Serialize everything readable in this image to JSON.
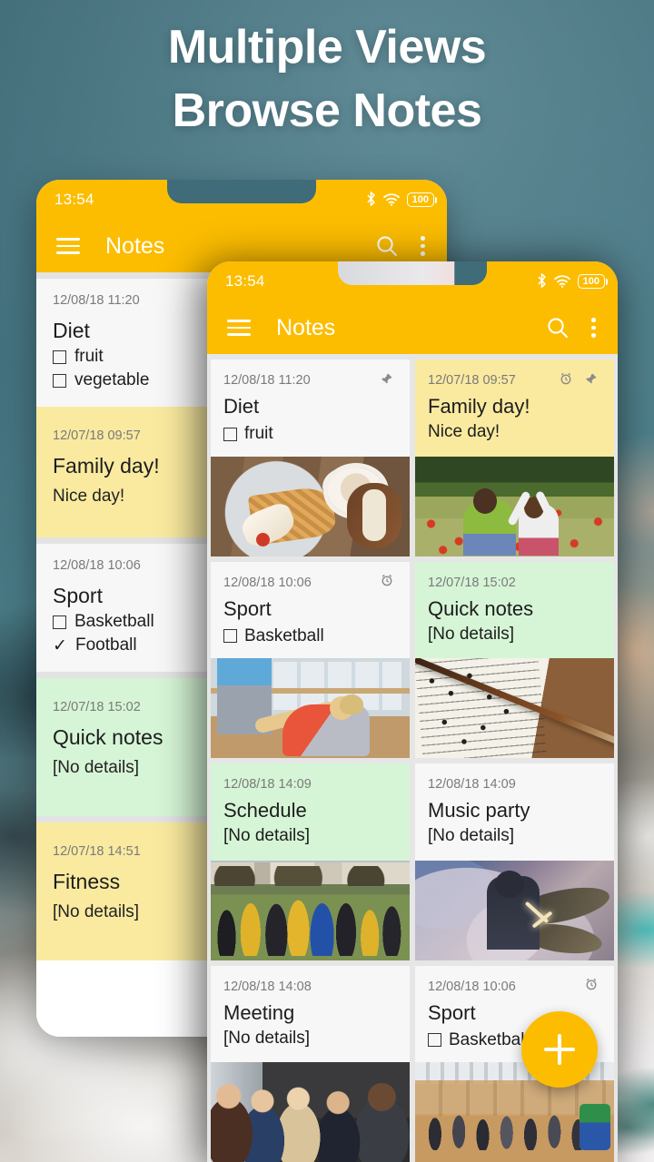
{
  "headline": {
    "line1": "Multiple Views",
    "line2": "Browse Notes"
  },
  "colors": {
    "toolbar": "#fcbd00",
    "accent_fab": "#fcbd00",
    "note_yellow": "#faeaa0",
    "note_green": "#d6f5d6",
    "note_white": "#f7f7f8",
    "background_teal": "#41707c"
  },
  "status_bar": {
    "time": "13:54",
    "bluetooth_icon": "bluetooth-icon",
    "wifi_icon": "wifi-icon",
    "battery_label": "100"
  },
  "toolbar": {
    "menu_icon": "hamburger-menu-icon",
    "title": "Notes",
    "search_icon": "search-icon",
    "overflow_icon": "overflow-menu-icon"
  },
  "fab": {
    "icon": "plus-icon",
    "label": "+"
  },
  "list_view": {
    "items": [
      {
        "date": "12/08/18 11:20",
        "title": "Diet",
        "color": "white",
        "pinned": true,
        "alarm": false,
        "checklist": [
          {
            "text": "fruit",
            "checked": false
          },
          {
            "text": "vegetable",
            "checked": false
          }
        ]
      },
      {
        "date": "12/07/18 09:57",
        "title": "Family day!",
        "subtitle": "Nice day!",
        "color": "yellow",
        "pinned": true,
        "alarm": true
      },
      {
        "date": "12/08/18 10:06",
        "title": "Sport",
        "color": "white",
        "pinned": false,
        "alarm": true,
        "checklist": [
          {
            "text": "Basketball",
            "checked": false
          },
          {
            "text": "Football",
            "checked": true
          }
        ]
      },
      {
        "date": "12/07/18 15:02",
        "title": "Quick notes",
        "subtitle": "[No details]",
        "color": "green",
        "pinned": false,
        "alarm": false
      },
      {
        "date": "12/07/18 14:51",
        "title": "Fitness",
        "subtitle": "[No details]",
        "color": "yellow",
        "pinned": false,
        "alarm": true
      }
    ]
  },
  "grid_view": {
    "cards": [
      {
        "date": "12/08/18 11:20",
        "title": "Diet",
        "color": "white",
        "pinned": true,
        "alarm": false,
        "checklist": [
          {
            "text": "fruit",
            "checked": false
          }
        ],
        "photo": "breakfast-waffles-photo"
      },
      {
        "date": "12/07/18 09:57",
        "title": "Family day!",
        "subtitle": "Nice day!",
        "color": "yellow",
        "pinned": true,
        "alarm": true,
        "photo": "mother-and-child-poppy-field-photo"
      },
      {
        "date": "12/08/18 10:06",
        "title": "Sport",
        "color": "white",
        "pinned": false,
        "alarm": true,
        "checklist": [
          {
            "text": "Basketball",
            "checked": false
          }
        ],
        "photo": "gym-stretching-photo"
      },
      {
        "date": "12/07/18 15:02",
        "title": "Quick notes",
        "subtitle": "[No details]",
        "color": "green",
        "pinned": false,
        "alarm": false,
        "photo": "sheet-music-violin-bow-photo"
      },
      {
        "date": "12/08/18 14:09",
        "title": "Schedule",
        "subtitle": "[No details]",
        "color": "green",
        "pinned": false,
        "alarm": false,
        "photo": "rugby-match-photo"
      },
      {
        "date": "12/08/18 14:09",
        "title": "Music party",
        "subtitle": "[No details]",
        "color": "white",
        "pinned": false,
        "alarm": false,
        "photo": "drummer-stage-smoke-photo"
      },
      {
        "date": "12/08/18 14:08",
        "title": "Meeting",
        "subtitle": "[No details]",
        "color": "white",
        "pinned": false,
        "alarm": false,
        "photo": "business-meeting-photo"
      },
      {
        "date": "12/08/18 10:06",
        "title": "Sport",
        "color": "white",
        "pinned": false,
        "alarm": true,
        "checklist": [
          {
            "text": "Basketball",
            "checked": false
          }
        ],
        "photo": "sports-hall-photo"
      }
    ]
  }
}
